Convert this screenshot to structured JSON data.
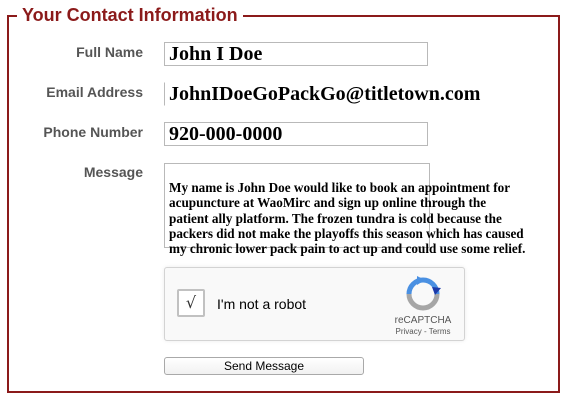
{
  "form": {
    "legend": "Your Contact Information",
    "full_name": {
      "label": "Full Name",
      "value": "John I Doe"
    },
    "email": {
      "label": "Email Address",
      "value": "JohnIDoeGoPackGo@titletown.com"
    },
    "phone": {
      "label": "Phone Number",
      "value": "920-000-0000"
    },
    "message": {
      "label": "Message",
      "value": "My name is John Doe would like to book an appointment for\nacupuncture at WaoMirc and sign up online through the\npatient ally platform. The frozen tundra is cold because the\npackers did not make the playoffs this season which has caused\nmy chronic lower pack pain to act up and could use some relief."
    },
    "recaptcha": {
      "checkbox_mark": "√",
      "label": "I'm not a robot",
      "brand": "reCAPTCHA",
      "links": "Privacy - Terms"
    },
    "send_label": "Send Message"
  },
  "colors": {
    "accent": "#8b1a1a",
    "label": "#555555",
    "recaptcha_blue": "#4a90e2",
    "recaptcha_gray": "#a6a6a6"
  },
  "icons": [
    "recaptcha-logo-icon",
    "checkmark-icon"
  ]
}
